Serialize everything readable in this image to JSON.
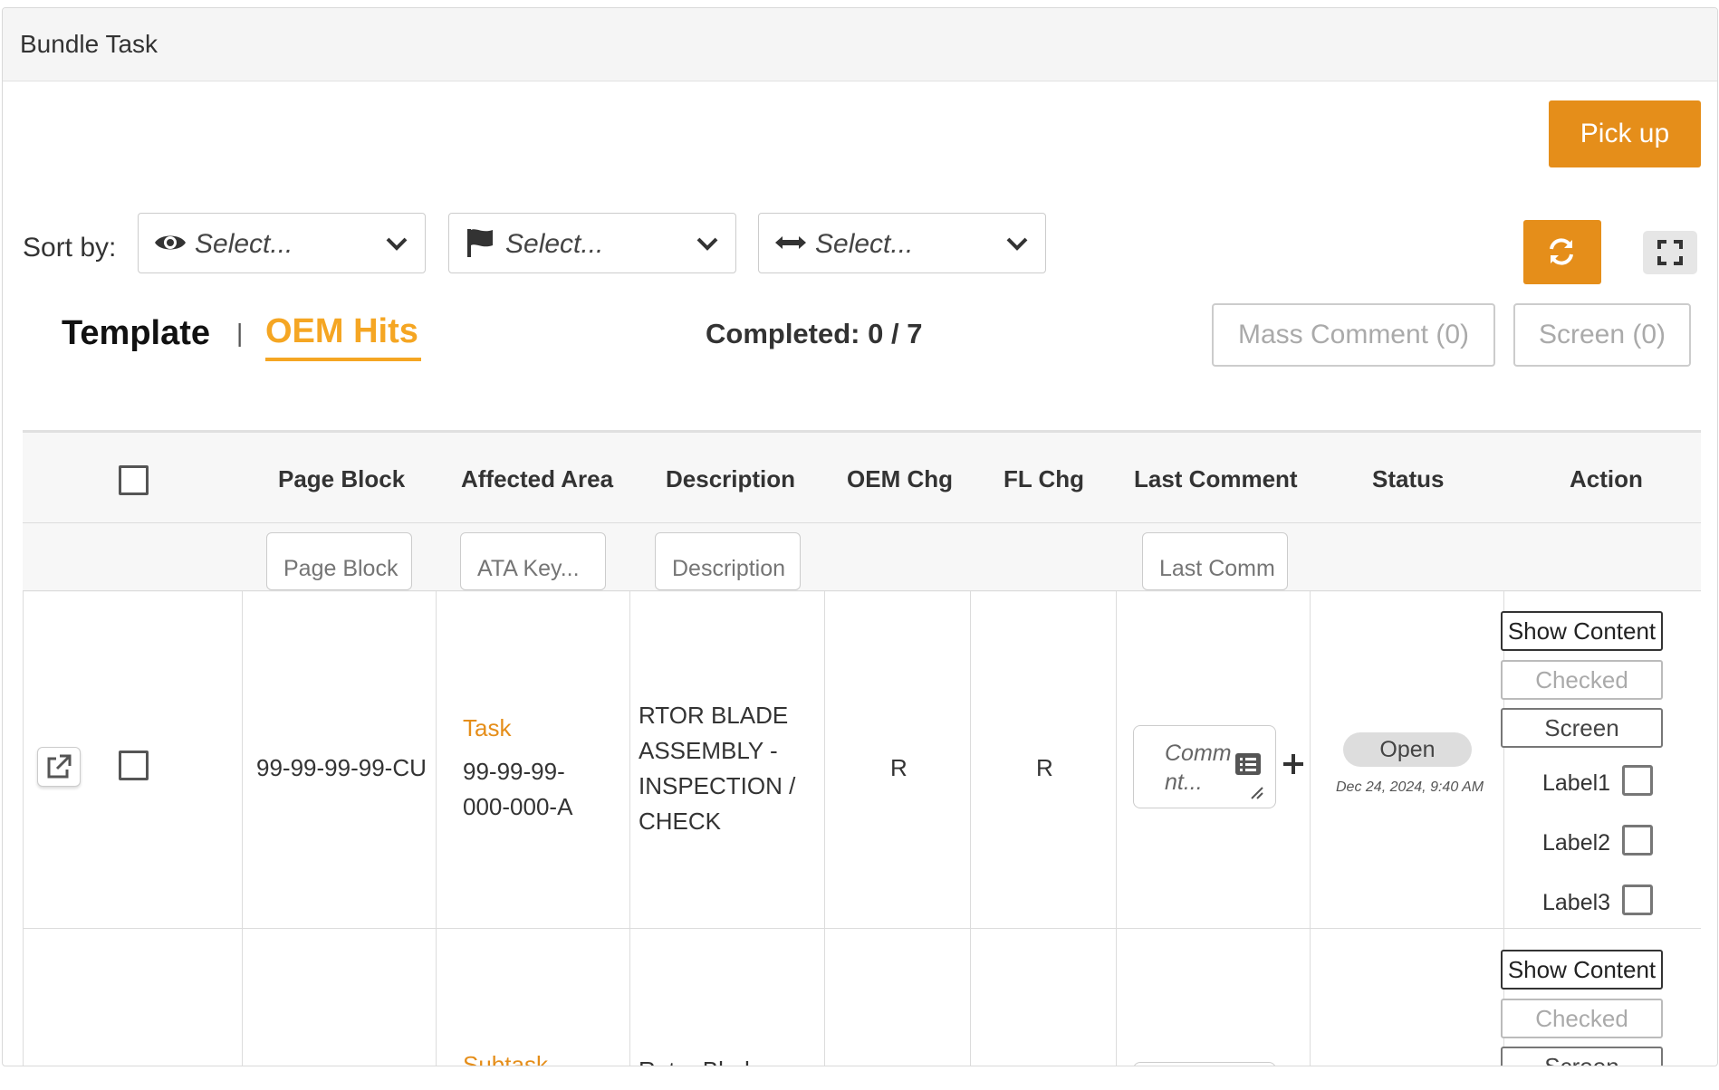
{
  "panel": {
    "title": "Bundle Task"
  },
  "toolbar": {
    "pickup_label": "Pick up"
  },
  "sort": {
    "label": "Sort by:",
    "selects": [
      {
        "icon": "eye-icon",
        "placeholder": "Select..."
      },
      {
        "icon": "flag-icon",
        "placeholder": "Select..."
      },
      {
        "icon": "arrows-horizontal-icon",
        "placeholder": "Select..."
      }
    ]
  },
  "tabs": {
    "template": "Template",
    "separator": "|",
    "oem_hits": "OEM Hits",
    "active": "OEM Hits"
  },
  "completed": "Completed: 0 / 7",
  "buttons": {
    "mass_comment": "Mass Comment (0)",
    "screen": "Screen (0)"
  },
  "table": {
    "columns": [
      "Page Block",
      "Affected Area",
      "Description",
      "OEM Chg",
      "FL Chg",
      "Last Comment",
      "Status",
      "Action"
    ],
    "filters": {
      "page_block": "Page Block",
      "affected_area": "ATA Key...",
      "description": "Description",
      "last_comment": "Last Comm"
    },
    "rows": [
      {
        "page_block": "99-99-99-99-CU",
        "type": "Task",
        "area": [
          "99-99-99-",
          "000-000-A"
        ],
        "description": [
          "RTOR BLADE",
          "ASSEMBLY -",
          "INSPECTION /",
          "CHECK"
        ],
        "oem_chg": "R",
        "fl_chg": "R",
        "comment_placeholder": "Comment...",
        "comment_lines": [
          "Comm",
          "nt..."
        ],
        "status": "Open",
        "status_date": "Dec 24, 2024, 9:40 AM",
        "actions": {
          "show_content": "Show Content",
          "checked": "Checked",
          "screen": "Screen"
        },
        "labels": [
          "Label1",
          "Label2",
          "Label3"
        ]
      },
      {
        "type": "Subtask",
        "description": [
          "Rotor Blade"
        ],
        "actions": {
          "show_content": "Show Content",
          "checked": "Checked",
          "screen": "Screen"
        }
      }
    ]
  },
  "colors": {
    "accent": "#e58e1a",
    "tab_active": "#f5a623"
  }
}
